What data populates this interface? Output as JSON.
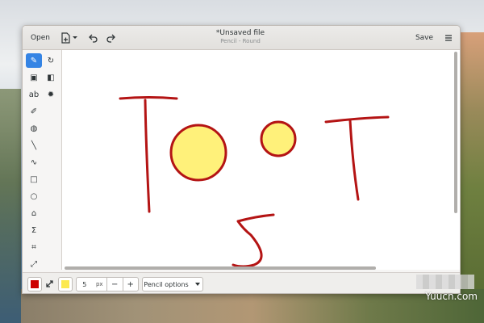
{
  "window": {
    "title": "*Unsaved file",
    "subtitle": "Pencil - Round"
  },
  "header": {
    "open_label": "Open",
    "save_label": "Save",
    "saveas_icon": "document-save-as-icon",
    "undo_icon": "undo-icon",
    "redo_icon": "redo-icon",
    "menu_icon": "hamburger-menu-icon"
  },
  "toolbox": {
    "tools": [
      {
        "name": "pencil",
        "glyph": "✎",
        "active": true
      },
      {
        "name": "refresh",
        "glyph": "↻",
        "active": false
      },
      {
        "name": "rectangle-select",
        "glyph": "▣",
        "active": false
      },
      {
        "name": "mirror",
        "glyph": "◧",
        "active": false
      },
      {
        "name": "text",
        "glyph": "ab",
        "active": false
      },
      {
        "name": "filters",
        "glyph": "✹",
        "active": false
      },
      {
        "name": "color-picker",
        "glyph": "✐",
        "active": false
      },
      {
        "name": "paint-bucket",
        "glyph": "◍",
        "active": false
      },
      {
        "name": "line",
        "glyph": "╲",
        "active": false
      },
      {
        "name": "curve",
        "glyph": "∿",
        "active": false
      },
      {
        "name": "rectangle",
        "glyph": "□",
        "active": false
      },
      {
        "name": "circle",
        "glyph": "○",
        "active": false
      },
      {
        "name": "free-shape",
        "glyph": "⌂",
        "active": false
      },
      {
        "name": "freehand-select",
        "glyph": "Σ",
        "active": false
      },
      {
        "name": "crop",
        "glyph": "⌗",
        "active": false
      },
      {
        "name": "scale",
        "glyph": "⤢",
        "active": false
      }
    ]
  },
  "colors": {
    "main": "#cc0000",
    "secondary": "#fce94f",
    "stroke": "#b41414",
    "fill": "#fff17a",
    "active_tool": "#3584e4"
  },
  "bottombar": {
    "size_value": "5",
    "size_unit": "px",
    "minus_label": "−",
    "plus_label": "+",
    "options_label": "Pencil options",
    "exchange_icon": "swap-colors-icon"
  },
  "watermark": {
    "text": "Yuucn.com"
  }
}
